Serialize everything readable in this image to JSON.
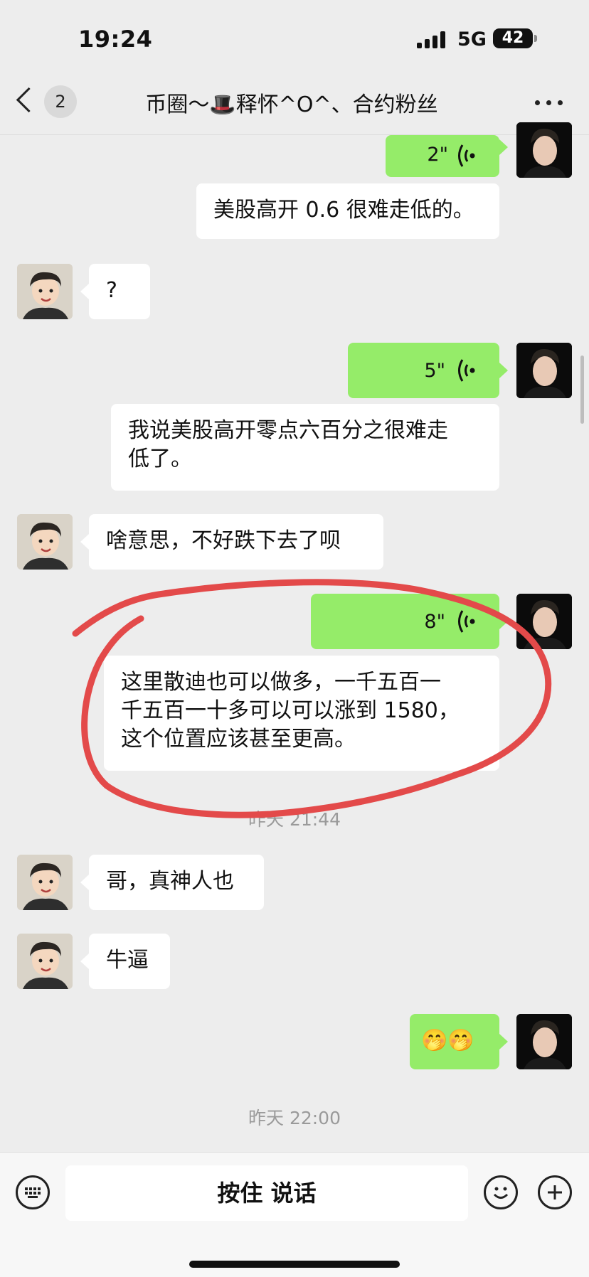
{
  "status_bar": {
    "time": "19:24",
    "network": "5G",
    "battery": "42"
  },
  "nav": {
    "unread_count": "2",
    "title": "币圈～🎩释怀^O^、合约粉丝"
  },
  "messages": [
    {
      "type": "voice",
      "from": "me",
      "duration": "2\""
    },
    {
      "type": "text",
      "from": "me",
      "text": "美股高开 0.6 很难走低的。"
    },
    {
      "type": "text",
      "from": "peer",
      "text": "?"
    },
    {
      "type": "voice",
      "from": "me",
      "duration": "5\""
    },
    {
      "type": "text",
      "from": "me",
      "lines": [
        "我说美股高开零点六百分之很难走",
        "低了。"
      ]
    },
    {
      "type": "text",
      "from": "peer",
      "text": "啥意思，不好跌下去了呗"
    },
    {
      "type": "voice",
      "from": "me",
      "duration": "8\""
    },
    {
      "type": "text",
      "from": "me",
      "lines": [
        "这里散迪也可以做多，一千五百一",
        "千五百一十多可以可以涨到 1580，",
        "这个位置应该甚至更高。"
      ]
    },
    {
      "type": "timestamp",
      "text": "昨天 21:44"
    },
    {
      "type": "text",
      "from": "peer",
      "text": "哥，真神人也"
    },
    {
      "type": "text",
      "from": "peer",
      "text": "牛逼"
    },
    {
      "type": "emoji",
      "from": "me",
      "text": "🤭🤭"
    },
    {
      "type": "timestamp",
      "text": "昨天 22:00"
    }
  ],
  "input_bar": {
    "voice_button_label": "按住 说话"
  },
  "colors": {
    "background": "#ededed",
    "my_bubble": "#95ec69",
    "peer_bubble": "#ffffff",
    "annotation": "#e34a4a"
  },
  "icons": [
    "back-icon",
    "more-icon",
    "voice-wave-icon",
    "keyboard-icon",
    "emoji-icon",
    "plus-icon"
  ]
}
